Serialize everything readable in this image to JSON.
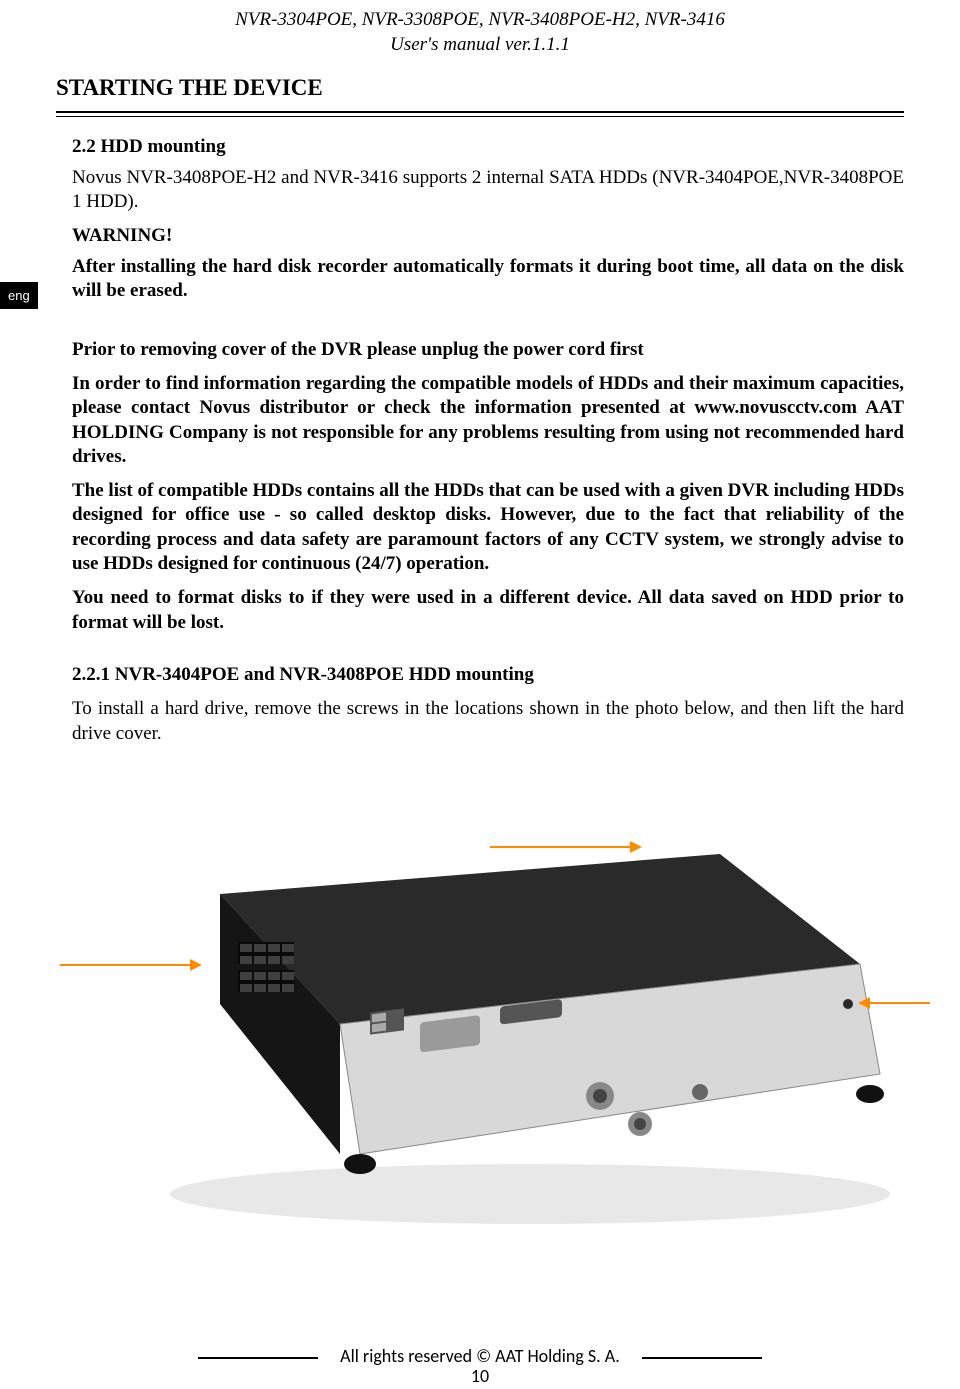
{
  "header": {
    "line1": "NVR-3304POE, NVR-3308POE, NVR-3408POE-H2, NVR-3416",
    "line2": "User's manual ver.1.1.1"
  },
  "section_title": "STARTING THE DEVICE",
  "lang_tab": "eng",
  "body": {
    "h_22": "2.2 HDD mounting",
    "p1": "Novus NVR-3408POE-H2 and NVR-3416  supports 2 internal SATA HDDs (NVR-3404POE,NVR-3408POE  1 HDD).",
    "warning_label": "WARNING!",
    "warning_text": "After installing the hard disk recorder automatically formats it during boot time, all data on the disk will be erased.",
    "p_prior": "Prior to removing cover of the DVR please unplug the power cord first",
    "p_info": "In order to find information regarding the compatible models of HDDs and their maximum capacities, please contact Novus distributor or check the information presented at www.novuscctv.com AAT HOLDING Company is not responsible for any problems resulting from using not recommended hard drives.",
    "p_list": "The list of compatible HDDs contains all the HDDs that can be used with a given DVR including HDDs designed for office use - so called desktop disks. However, due to the fact that reliability of the recording process and data safety are paramount factors of any CCTV system, we strongly advise to use HDDs designed for continuous (24/7) operation.",
    "p_format": "You need to format disks to if they were used in a different device. All data saved on HDD prior to format will be lost.",
    "h_221": "2.2.1  NVR-3404POE and NVR-3408POE  HDD mounting",
    "p_install": "To install a hard drive, remove the screws in the locations shown in the photo below, and then lift the hard drive cover."
  },
  "footer": {
    "rights": "All rights reserved © AAT Holding S. A.",
    "page_number": "10"
  }
}
